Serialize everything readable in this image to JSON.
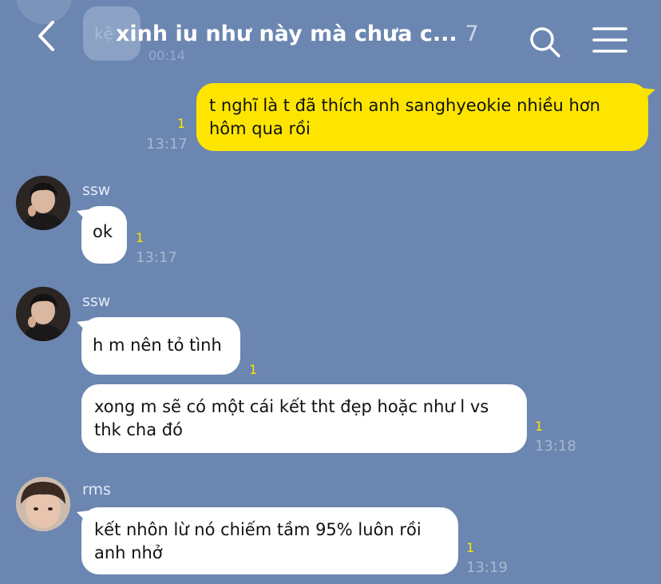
{
  "header": {
    "title": "xinh iu như này mà chưa c...",
    "member_count": "7",
    "back_icon": "chevron-left-icon",
    "search_icon": "search-icon",
    "menu_icon": "hamburger-menu-icon"
  },
  "ghost": {
    "text": "kệ",
    "time": "00:14"
  },
  "colors": {
    "background": "#6b86b0",
    "my_bubble": "#fee500",
    "their_bubble": "#ffffff",
    "unread": "#fee500"
  },
  "messages": [
    {
      "from": "me",
      "text_line1": "t nghĩ là t đã thích anh sanghyeokie nhiều hơn",
      "text_line2": "hôm qua rồi",
      "unread": "1",
      "time": "13:17"
    },
    {
      "from": "ssw",
      "sender": "ssw",
      "text": "ok",
      "unread": "1",
      "time": "13:17"
    },
    {
      "from": "ssw",
      "sender": "ssw",
      "text": "h m nên tỏ tình",
      "unread": "1"
    },
    {
      "from": "ssw",
      "text_line1": "xong m sẽ có một cái kết tht đẹp hoặc như l vs",
      "text_line2": "thk cha đó",
      "unread": "1",
      "time": "13:18"
    },
    {
      "from": "rms",
      "sender": "rms",
      "text_line1": "kết nhôn lừ nó chiếm tầm 95% luôn rồi",
      "text_line2": "anh nhở",
      "unread": "1",
      "time": "13:19"
    }
  ]
}
